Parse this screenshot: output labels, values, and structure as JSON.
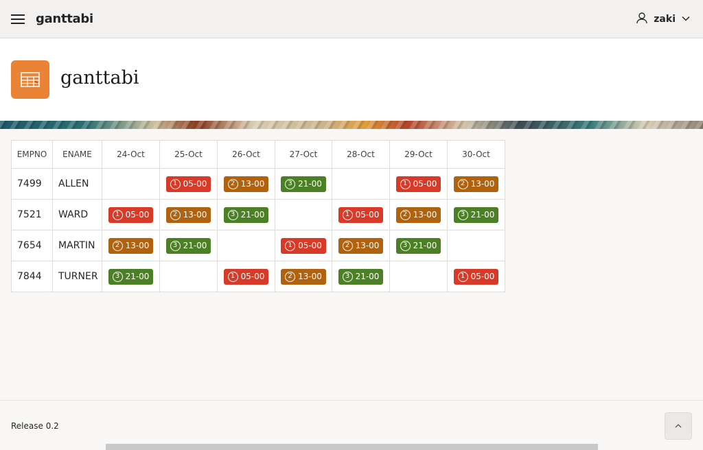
{
  "header": {
    "app_title": "ganttabi",
    "user_name": "zaki"
  },
  "hero": {
    "title": "ganttabi"
  },
  "table": {
    "col_empno": "EMPNO",
    "col_ename": "ENAME",
    "dates": [
      "24-Oct",
      "25-Oct",
      "26-Oct",
      "27-Oct",
      "28-Oct",
      "29-Oct",
      "30-Oct"
    ],
    "rows": [
      {
        "empno": "7499",
        "ename": "ALLEN",
        "cells": [
          null,
          {
            "n": "1",
            "t": "05-00"
          },
          {
            "n": "2",
            "t": "13-00"
          },
          {
            "n": "3",
            "t": "21-00"
          },
          null,
          {
            "n": "1",
            "t": "05-00"
          },
          {
            "n": "2",
            "t": "13-00"
          }
        ]
      },
      {
        "empno": "7521",
        "ename": "WARD",
        "cells": [
          {
            "n": "1",
            "t": "05-00"
          },
          {
            "n": "2",
            "t": "13-00"
          },
          {
            "n": "3",
            "t": "21-00"
          },
          null,
          {
            "n": "1",
            "t": "05-00"
          },
          {
            "n": "2",
            "t": "13-00"
          },
          {
            "n": "3",
            "t": "21-00"
          }
        ]
      },
      {
        "empno": "7654",
        "ename": "MARTIN",
        "cells": [
          {
            "n": "2",
            "t": "13-00"
          },
          {
            "n": "3",
            "t": "21-00"
          },
          null,
          {
            "n": "1",
            "t": "05-00"
          },
          {
            "n": "2",
            "t": "13-00"
          },
          {
            "n": "3",
            "t": "21-00"
          },
          null
        ]
      },
      {
        "empno": "7844",
        "ename": "TURNER",
        "cells": [
          {
            "n": "3",
            "t": "21-00"
          },
          null,
          {
            "n": "1",
            "t": "05-00"
          },
          {
            "n": "2",
            "t": "13-00"
          },
          {
            "n": "3",
            "t": "21-00"
          },
          null,
          {
            "n": "1",
            "t": "05-00"
          }
        ]
      }
    ]
  },
  "shift_colors": {
    "1": "#d93a27",
    "2": "#b0620f",
    "3": "#4b8024"
  },
  "footer": {
    "release": "Release 0.2"
  },
  "icons": {
    "menu": "hamburger-icon",
    "user": "user-icon",
    "caret": "chevron-down-icon",
    "hero": "table-icon",
    "top": "chevron-up-icon"
  }
}
